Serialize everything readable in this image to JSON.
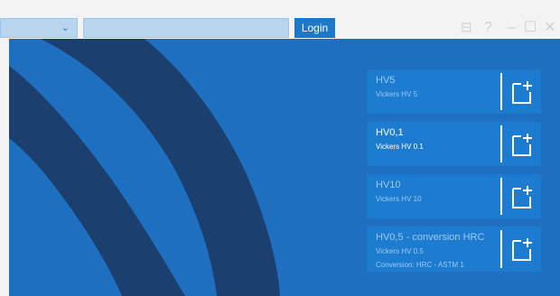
{
  "toolbar": {
    "login_label": "Login",
    "search_value": "",
    "select_value": ""
  },
  "window_controls": {
    "icons": [
      "layout-icon",
      "help-icon",
      "minimize-icon",
      "maximize-icon",
      "close-icon"
    ],
    "help_label": "?"
  },
  "test_methods": [
    {
      "title": "HV5",
      "subtitle": "Vickers HV 5",
      "detail": ""
    },
    {
      "title": "HV0,1",
      "subtitle": "Vickers HV 0.1",
      "detail": ""
    },
    {
      "title": "HV10",
      "subtitle": "Vickers HV 10",
      "detail": ""
    },
    {
      "title": "HV0,5 - conversion HRC",
      "subtitle": "Vickers HV 0.5",
      "detail": "Conversion: HRC - ASTM 1"
    }
  ],
  "colors": {
    "accent": "#1e78c8",
    "background": "#1f6fc0",
    "card": "#1e7cd0",
    "swoosh": "#1b3f6e"
  }
}
